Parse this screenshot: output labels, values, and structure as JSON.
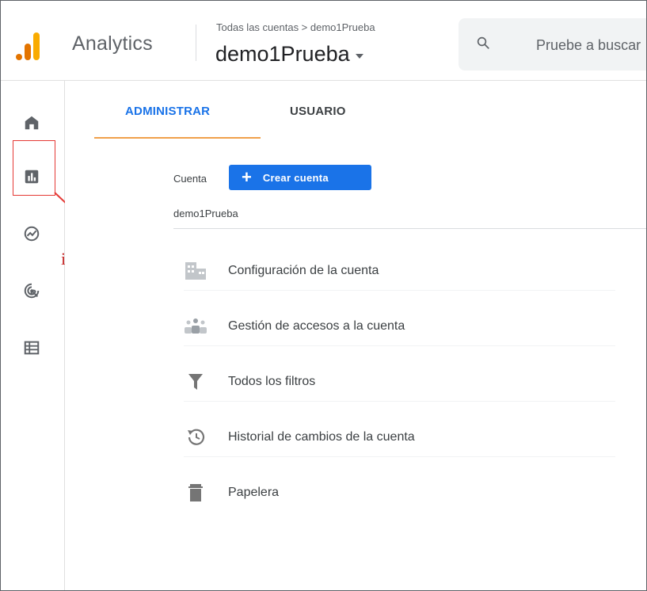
{
  "header": {
    "app_name": "Analytics",
    "breadcrumb": "Todas las cuentas > demo1Prueba",
    "account_title": "demo1Prueba",
    "search_placeholder": "Pruebe a buscar"
  },
  "rail": {
    "icons": [
      "home-icon",
      "reports-icon",
      "explore-icon",
      "advertising-icon",
      "configure-icon"
    ]
  },
  "annotation": {
    "label": "informes",
    "color": "#e53935"
  },
  "tabs": [
    {
      "label": "ADMINISTRAR",
      "active": true
    },
    {
      "label": "USUARIO",
      "active": false
    }
  ],
  "account": {
    "label": "Cuenta",
    "create_button": "Crear cuenta",
    "name": "demo1Prueba"
  },
  "menu": [
    {
      "label": "Configuración de la cuenta",
      "icon": "building-icon"
    },
    {
      "label": "Gestión de accesos a la cuenta",
      "icon": "people-icon"
    },
    {
      "label": "Todos los filtros",
      "icon": "filter-icon"
    },
    {
      "label": "Historial de cambios de la cuenta",
      "icon": "history-icon"
    },
    {
      "label": "Papelera",
      "icon": "trash-icon"
    }
  ],
  "colors": {
    "accent": "#1a73e8",
    "logo_orange": "#e37400",
    "logo_yellow": "#f9ab00",
    "tab_indicator": "#f0a04b"
  }
}
